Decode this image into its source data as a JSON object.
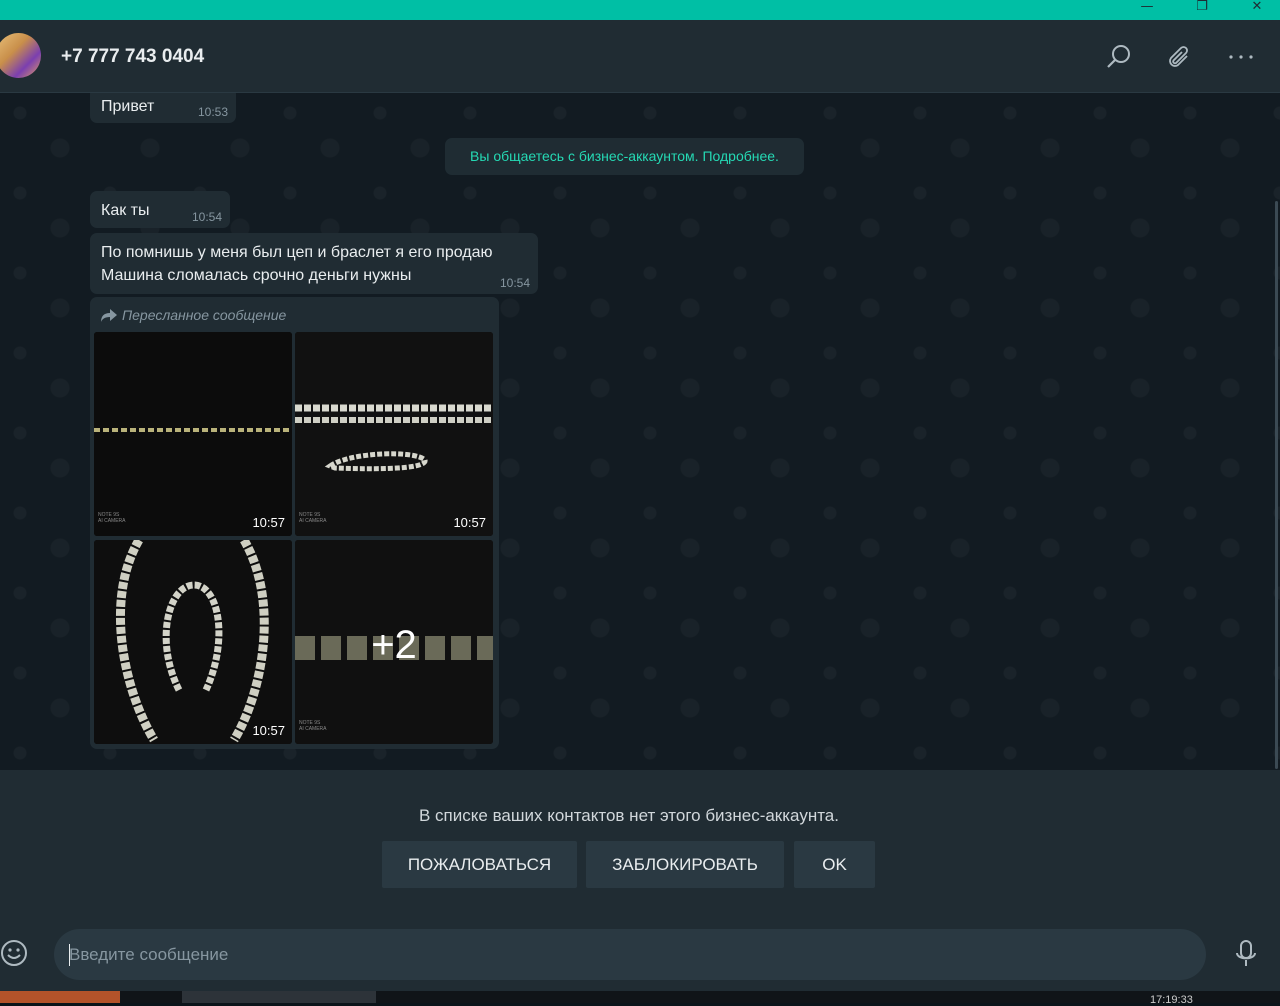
{
  "window": {
    "minimize_glyph": "—",
    "maximize_glyph": "❐",
    "close_glyph": "✕"
  },
  "header": {
    "contact": "+7 777 743 0404",
    "icons": [
      "search-icon",
      "attach-icon",
      "more-icon"
    ]
  },
  "messages": [
    {
      "text": "Привет",
      "time": "10:53"
    },
    {
      "text": "Как ты",
      "time": "10:54"
    },
    {
      "text": "По помнишь у меня был цеп и браслет я его продаю\nМашина сломалась срочно деньги нужны",
      "time": "10:54"
    }
  ],
  "system_message": "Вы общаетесь с бизнес-аккаунтом. Подробнее.",
  "forwarded": {
    "label": "Пересланное сообщение",
    "photos": [
      {
        "time": "10:57",
        "camera_text": "NOTE 9S\nAI CAMERA"
      },
      {
        "time": "10:57",
        "camera_text": "NOTE 9S\nAI CAMERA"
      },
      {
        "time": "10:57",
        "camera_text": ""
      },
      {
        "time": "",
        "camera_text": "NOTE 9S\nAI CAMERA",
        "more_count": "+2"
      }
    ]
  },
  "notice": {
    "text": "В списке ваших контактов нет этого бизнес-аккаунта.",
    "buttons": [
      "ПОЖАЛОВАТЬСЯ",
      "ЗАБЛОКИРОВАТЬ",
      "OK"
    ]
  },
  "composer": {
    "placeholder": "Введите сообщение"
  },
  "taskbar": {
    "clock": "17:19:33"
  },
  "colors": {
    "accent": "#00bfa5",
    "system_text": "#25d9b4",
    "bubble": "#202c33",
    "background": "#121b22"
  }
}
